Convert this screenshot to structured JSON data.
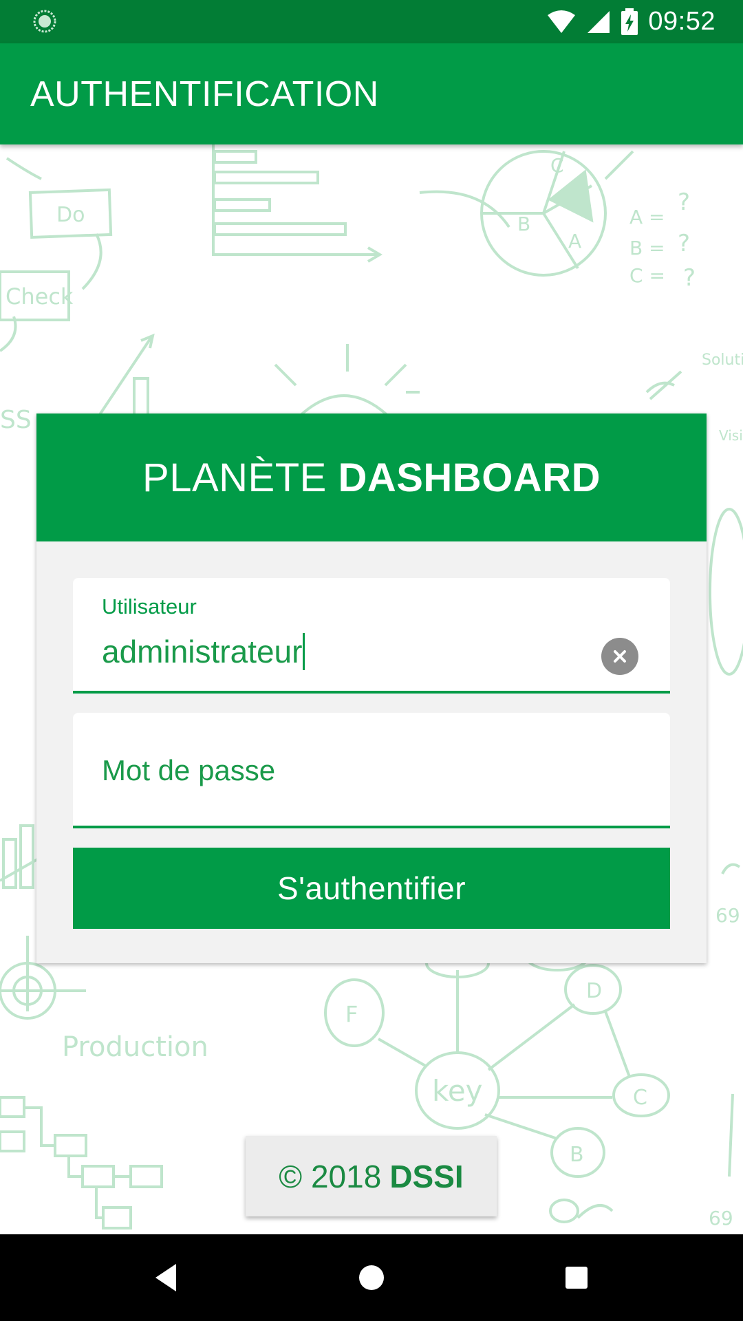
{
  "status_bar": {
    "time": "09:52"
  },
  "app_bar": {
    "title": "AUTHENTIFICATION"
  },
  "card": {
    "title_light": "PLANÈTE",
    "title_bold": "DASHBOARD"
  },
  "form": {
    "user": {
      "label": "Utilisateur",
      "value": "administrateur"
    },
    "password": {
      "placeholder": "Mot de passe"
    },
    "submit_label": "S'authentifier"
  },
  "footer": {
    "copyright": "© 2018",
    "org": "DSSI"
  },
  "background_doodles": {
    "texts": [
      "Do",
      "Check",
      "A =",
      "B =",
      "C =",
      "?",
      "B",
      "A",
      "C",
      "Solutio",
      "Visi",
      "Production",
      "key",
      "F",
      "D",
      "C",
      "B",
      "SS",
      "69",
      "69"
    ]
  },
  "colors": {
    "primary": "#019b47",
    "status_bar": "#027d35",
    "card_bg": "#f2f2f2",
    "doodle": "#bfe5cc"
  },
  "icons": {
    "status": [
      "app-notification-icon",
      "wifi-icon",
      "signal-icon",
      "battery-charging-icon"
    ],
    "nav": [
      "back-icon",
      "home-icon",
      "recents-icon"
    ],
    "clear": "clear-icon"
  }
}
